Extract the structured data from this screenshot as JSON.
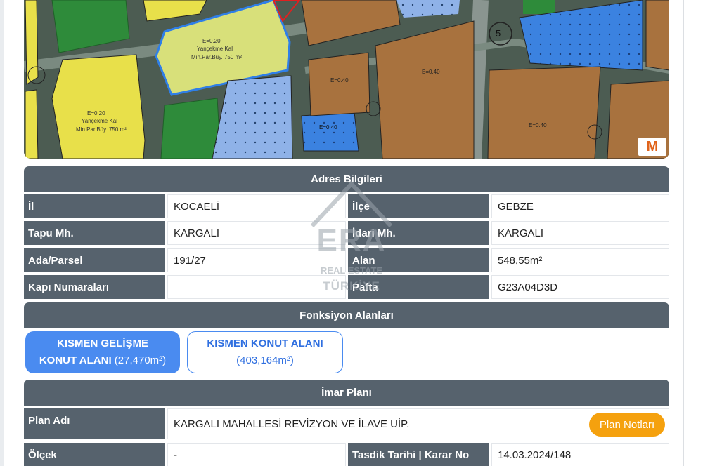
{
  "map": {
    "labels": [
      {
        "text": "E=0.20"
      },
      {
        "text": "Yançekme Kal"
      },
      {
        "text": "Min.Par.Büy. 750 m²"
      },
      {
        "text": "E=0.20"
      },
      {
        "text": "Yançekme Kal"
      },
      {
        "text": "Min.Par.Büy. 750 m²"
      },
      {
        "text": "E=0.40"
      },
      {
        "text": "E=0.40"
      },
      {
        "text": "E=0.40"
      },
      {
        "text": "E=0.40"
      },
      {
        "text": "5"
      }
    ],
    "logo_text": "M",
    "colors": {
      "yellow": "#e8e04a",
      "lightyellow": "#d8e07a",
      "green": "#2e8b3a",
      "blue": "#3b82e0",
      "brown": "#a8723e",
      "road": "#5a6b60"
    }
  },
  "address": {
    "header": "Adres Bilgileri",
    "rows": [
      {
        "label_left": "İl",
        "value_left": "KOCAELİ",
        "label_right": "İlçe",
        "value_right": "GEBZE"
      },
      {
        "label_left": "Tapu Mh.",
        "value_left": "KARGALI",
        "label_right": "İdari Mh.",
        "value_right": "KARGALI"
      },
      {
        "label_left": "Ada/Parsel",
        "value_left": "191/27",
        "label_right": "Alan",
        "value_right": "548,55m²"
      },
      {
        "label_left": "Kapı Numaraları",
        "value_left": "",
        "label_right": "Pafta",
        "value_right": "G23A04D3D"
      }
    ]
  },
  "functions": {
    "header": "Fonksiyon Alanları",
    "tags": [
      {
        "line1": "KISMEN GELİŞME",
        "line2_strong": "KONUT ALANI",
        "line2_area": "(27,470m²)"
      },
      {
        "line1": "KISMEN KONUT ALANI",
        "line2_area": "(403,164m²)"
      }
    ]
  },
  "imar": {
    "header": "İmar Planı",
    "plan_label": "Plan Adı",
    "plan_value": "KARGALI MAHALLESİ REVİZYON VE İLAVE UİP.",
    "plan_button": "Plan Notları",
    "scale_label": "Ölçek",
    "scale_value": "-",
    "date_label": "Tasdik Tarihi | Karar No",
    "date_value": "14.03.2024/148"
  },
  "watermark": {
    "brand": "ERA",
    "line1": "REAL ESTATE",
    "line2": "TÜRKİYE"
  }
}
